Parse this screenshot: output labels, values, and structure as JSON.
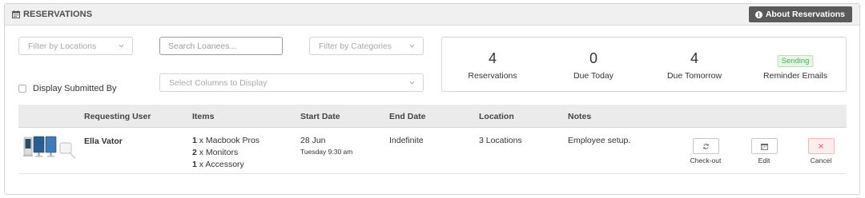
{
  "header": {
    "title": "RESERVATIONS",
    "about_button": "About Reservations"
  },
  "filters": {
    "locations_placeholder": "Filter by Locations",
    "search_placeholder": "Search Loanees...",
    "categories_placeholder": "Filter by Categories",
    "columns_placeholder": "Select Columns to Display",
    "display_submitted_by": "Display Submitted By"
  },
  "stats": [
    {
      "value": "4",
      "label": "Reservations"
    },
    {
      "value": "0",
      "label": "Due Today"
    },
    {
      "value": "4",
      "label": "Due Tomorrow"
    },
    {
      "badge": "Sending",
      "label": "Reminder Emails"
    }
  ],
  "table": {
    "columns": [
      "Requesting User",
      "Items",
      "Start Date",
      "End Date",
      "Location",
      "Notes"
    ],
    "rows": [
      {
        "user": "Ella Vator",
        "items": [
          {
            "qty": "1",
            "text": " x Macbook Pros"
          },
          {
            "qty": "2",
            "text": " x Monitors"
          },
          {
            "qty": "1",
            "text": " x Accessory"
          }
        ],
        "start_date": "28 Jun",
        "start_time": "Tuesday 9:30 am",
        "end_date": "Indefinite",
        "location": "3 Locations",
        "notes": "Employee setup.",
        "actions": {
          "checkout": "Check-out",
          "edit": "Edit",
          "cancel": "Cancel"
        }
      }
    ]
  },
  "colors": {
    "about_button_bg": "#5a5a5a",
    "header_bg": "#f0f0f0",
    "badge_green": "#4caf50",
    "cancel_red": "#e06666"
  },
  "icons": {
    "header": "calendar-icon",
    "about": "info-icon",
    "checkout": "refresh-icon",
    "edit": "calendar-icon",
    "cancel": "close-icon"
  }
}
